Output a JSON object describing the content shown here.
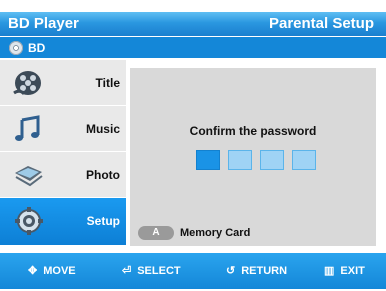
{
  "header": {
    "title": "BD Player",
    "section": "Parental Setup"
  },
  "source": {
    "label": "BD",
    "icon": "disc-icon"
  },
  "sidebar": {
    "items": [
      {
        "label": "Title",
        "icon": "film-reel-icon",
        "active": false
      },
      {
        "label": "Music",
        "icon": "music-note-icon",
        "active": false
      },
      {
        "label": "Photo",
        "icon": "photo-icon",
        "active": false
      },
      {
        "label": "Setup",
        "icon": "gear-icon",
        "active": true
      }
    ]
  },
  "panel": {
    "prompt": "Confirm the password",
    "password_boxes": 4,
    "active_box": 0,
    "hint_button": "A",
    "hint_label": "Memory Card"
  },
  "footer": {
    "move": "MOVE",
    "select": "SELECT",
    "return": "RETURN",
    "exit": "EXIT"
  },
  "colors": {
    "accent": "#1487d8",
    "highlight": "#1a93e6",
    "panel": "#d9d9d9"
  }
}
